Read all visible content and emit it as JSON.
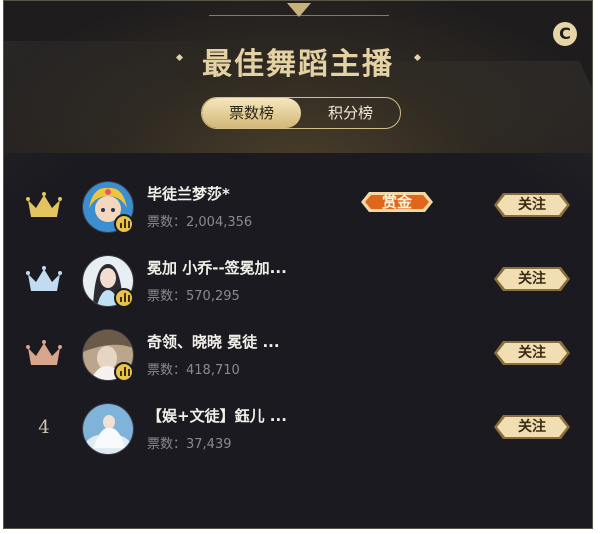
{
  "header": {
    "title": "最佳舞蹈主播",
    "coin_icon_text": "C",
    "tabs": [
      {
        "label": "票数榜",
        "active": true
      },
      {
        "label": "积分榜",
        "active": false
      }
    ]
  },
  "colors": {
    "gold": "#e4d2a4",
    "background": "#1b1a20",
    "crown_gold": "#e3c45e",
    "crown_silver": "#c3dbf0",
    "crown_bronze": "#d9a48c",
    "reward_orange": "#e0661c"
  },
  "ranking": [
    {
      "rank": "1",
      "rank_icon": "gold-crown-icon",
      "name": "毕徒兰梦莎*",
      "votes": "票数：2,004,356",
      "reward": "赏金",
      "follow": "关注"
    },
    {
      "rank": "2",
      "rank_icon": "silver-crown-icon",
      "name": "冕加 小乔--签冕加...",
      "votes": "票数：570,295",
      "follow": "关注"
    },
    {
      "rank": "3",
      "rank_icon": "bronze-crown-icon",
      "name": "奇领、晓晓 冕徒 ...",
      "votes": "票数：418,710",
      "follow": "关注"
    },
    {
      "rank": "4",
      "name": "【娱+文徒】鈺儿 ...",
      "votes": "票数：37,439",
      "follow": "关注"
    }
  ]
}
